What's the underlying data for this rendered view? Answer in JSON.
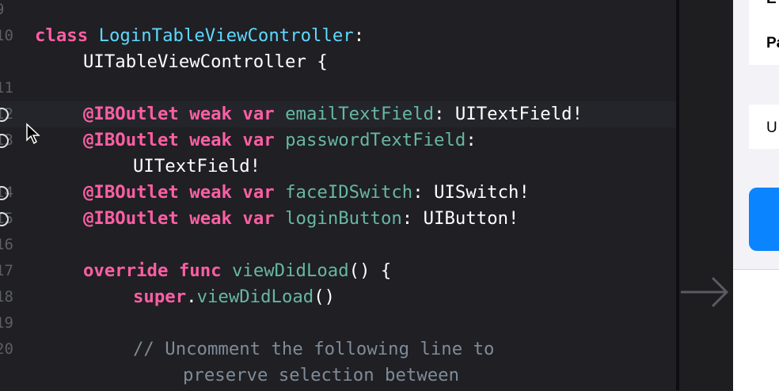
{
  "editor": {
    "lines": [
      {
        "number": "9",
        "outlet": false,
        "highlight": false,
        "indent": 0,
        "tokens": []
      },
      {
        "number": "10",
        "outlet": false,
        "highlight": false,
        "indent": 1,
        "tokens": [
          {
            "t": "class",
            "c": "kw"
          },
          {
            "t": " ",
            "c": "plain"
          },
          {
            "t": "LoginTableViewController",
            "c": "type-decl"
          },
          {
            "t": ":",
            "c": "plain"
          }
        ]
      },
      {
        "number": "",
        "outlet": false,
        "highlight": false,
        "indent": 4,
        "tokens": [
          {
            "t": "UITableViewController {",
            "c": "plain"
          }
        ]
      },
      {
        "number": "11",
        "outlet": false,
        "highlight": false,
        "indent": 0,
        "tokens": []
      },
      {
        "number": "12",
        "outlet": true,
        "highlight": true,
        "indent": 4,
        "tokens": [
          {
            "t": "@IBOutlet",
            "c": "kw"
          },
          {
            "t": " ",
            "c": "plain"
          },
          {
            "t": "weak",
            "c": "kw"
          },
          {
            "t": " ",
            "c": "plain"
          },
          {
            "t": "var",
            "c": "kw"
          },
          {
            "t": " ",
            "c": "plain"
          },
          {
            "t": "emailTextField",
            "c": "prop"
          },
          {
            "t": ": UITextField!",
            "c": "plain"
          }
        ]
      },
      {
        "number": "13",
        "outlet": true,
        "highlight": false,
        "indent": 4,
        "tokens": [
          {
            "t": "@IBOutlet",
            "c": "kw"
          },
          {
            "t": " ",
            "c": "plain"
          },
          {
            "t": "weak",
            "c": "kw"
          },
          {
            "t": " ",
            "c": "plain"
          },
          {
            "t": "var",
            "c": "kw"
          },
          {
            "t": " ",
            "c": "plain"
          },
          {
            "t": "passwordTextField",
            "c": "prop"
          },
          {
            "t": ":",
            "c": "plain"
          }
        ]
      },
      {
        "number": "",
        "outlet": false,
        "highlight": false,
        "indent": 8,
        "tokens": [
          {
            "t": "UITextField!",
            "c": "plain"
          }
        ]
      },
      {
        "number": "14",
        "outlet": true,
        "highlight": false,
        "indent": 4,
        "tokens": [
          {
            "t": "@IBOutlet",
            "c": "kw"
          },
          {
            "t": " ",
            "c": "plain"
          },
          {
            "t": "weak",
            "c": "kw"
          },
          {
            "t": " ",
            "c": "plain"
          },
          {
            "t": "var",
            "c": "kw"
          },
          {
            "t": " ",
            "c": "plain"
          },
          {
            "t": "faceIDSwitch",
            "c": "prop"
          },
          {
            "t": ": UISwitch!",
            "c": "plain"
          }
        ]
      },
      {
        "number": "15",
        "outlet": true,
        "highlight": false,
        "indent": 4,
        "tokens": [
          {
            "t": "@IBOutlet",
            "c": "kw"
          },
          {
            "t": " ",
            "c": "plain"
          },
          {
            "t": "weak",
            "c": "kw"
          },
          {
            "t": " ",
            "c": "plain"
          },
          {
            "t": "var",
            "c": "kw"
          },
          {
            "t": " ",
            "c": "plain"
          },
          {
            "t": "loginButton",
            "c": "prop"
          },
          {
            "t": ": UIButton!",
            "c": "plain"
          }
        ]
      },
      {
        "number": "16",
        "outlet": false,
        "highlight": false,
        "indent": 0,
        "tokens": []
      },
      {
        "number": "17",
        "outlet": false,
        "highlight": false,
        "indent": 4,
        "tokens": [
          {
            "t": "override",
            "c": "kw"
          },
          {
            "t": " ",
            "c": "plain"
          },
          {
            "t": "func",
            "c": "kw"
          },
          {
            "t": " ",
            "c": "plain"
          },
          {
            "t": "viewDidLoad",
            "c": "fn"
          },
          {
            "t": "() {",
            "c": "plain"
          }
        ]
      },
      {
        "number": "18",
        "outlet": false,
        "highlight": false,
        "indent": 8,
        "tokens": [
          {
            "t": "super",
            "c": "kw"
          },
          {
            "t": ".",
            "c": "plain"
          },
          {
            "t": "viewDidLoad",
            "c": "fn"
          },
          {
            "t": "()",
            "c": "plain"
          }
        ]
      },
      {
        "number": "19",
        "outlet": false,
        "highlight": false,
        "indent": 0,
        "tokens": []
      },
      {
        "number": "20",
        "outlet": false,
        "highlight": false,
        "indent": 8,
        "tokens": [
          {
            "t": "// Uncomment the following line to",
            "c": "comment"
          }
        ]
      },
      {
        "number": "",
        "outlet": false,
        "highlight": false,
        "indent": 12,
        "tokens": [
          {
            "t": "preserve selection between",
            "c": "comment"
          }
        ]
      }
    ]
  },
  "simulator": {
    "email_label_partial": "E",
    "password_label_partial": "Pa",
    "field_text_partial": "U"
  },
  "colors": {
    "editor_bg": "#1f1f24",
    "keyword": "#fc5fa3",
    "type_declaration": "#5dd8ff",
    "identifier": "#67b7a4",
    "comment": "#7f8c98",
    "accent_button": "#0a84ff"
  },
  "icons": [
    "outlet-connection-circle-icon",
    "mouse-cursor-icon",
    "segue-arrow-icon"
  ]
}
